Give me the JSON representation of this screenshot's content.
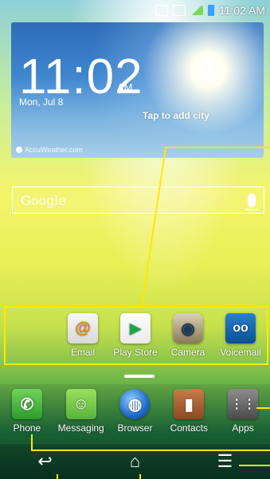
{
  "status_bar": {
    "time": "11:02 AM",
    "icons": [
      "screen-mirror-icon",
      "nfc-icon",
      "data-network-icon",
      "signal-icon",
      "battery-icon"
    ]
  },
  "weather_widget": {
    "time": "11:02",
    "ampm": "AM",
    "date": "Mon, Jul 8",
    "city_prompt": "Tap to add city",
    "provider": "AccuWeather.com"
  },
  "search_bar": {
    "label": "Google",
    "icons": [
      "google-logo",
      "mic-icon"
    ]
  },
  "favorite_apps": [
    {
      "label": "Email",
      "icon": "@"
    },
    {
      "label": "Play Store",
      "icon": "▶"
    },
    {
      "label": "Camera",
      "icon": "◉"
    },
    {
      "label": "Voicemail",
      "icon": "oo"
    }
  ],
  "dock_apps": [
    {
      "label": "Phone",
      "icon": "✆"
    },
    {
      "label": "Messaging",
      "icon": "☺"
    },
    {
      "label": "Browser",
      "icon": "◍"
    },
    {
      "label": "Contacts",
      "icon": "▮"
    },
    {
      "label": "Apps",
      "icon": "⋮⋮"
    }
  ],
  "nav_bar": {
    "back": "↩",
    "home": "⌂",
    "menu": "☰"
  },
  "accent_color": "#ffe800"
}
